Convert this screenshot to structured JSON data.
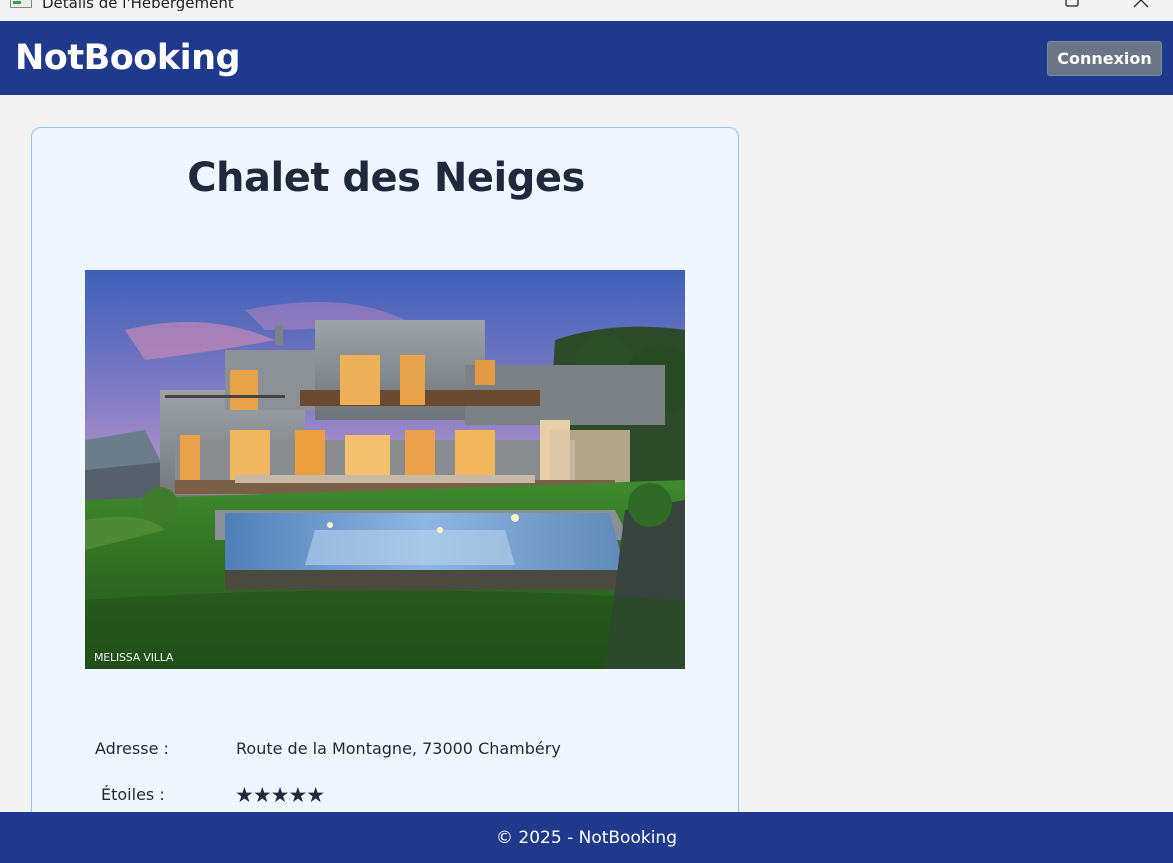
{
  "window": {
    "title": "Détails de l'Hébergement"
  },
  "header": {
    "brand": "NotBooking",
    "login_label": "Connexion"
  },
  "listing": {
    "name": "Chalet des Neiges",
    "photo_watermark": "MELISSA VILLA",
    "address_label": "Adresse :",
    "address_value": "Route de la Montagne, 73000 Chambéry",
    "stars_label": "Étoiles :",
    "stars_display": "★★★★★",
    "star_rating": 5
  },
  "footer": {
    "copyright": "© 2025 - NotBooking"
  },
  "colors": {
    "brand_blue": "#1f3a8c",
    "card_background": "#eff6ff",
    "card_border": "#93c5fd",
    "button_gray": "#6b7588",
    "text_dark": "#1e293b"
  }
}
